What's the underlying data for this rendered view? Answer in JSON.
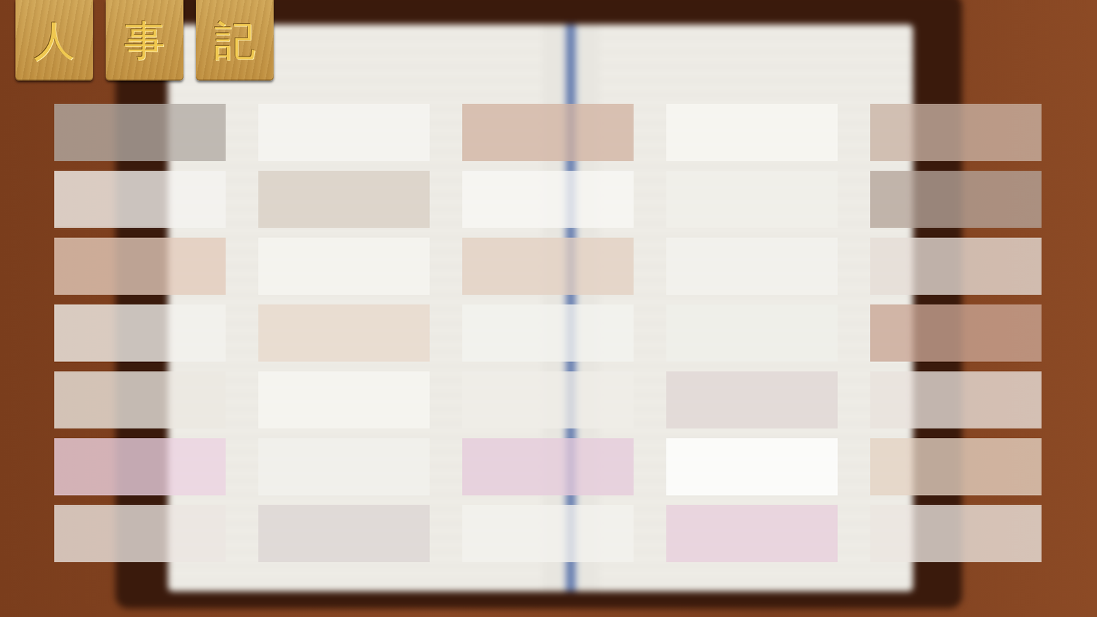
{
  "menu_tiles": [
    {
      "label": "人"
    },
    {
      "label": "事"
    },
    {
      "label": "記"
    }
  ],
  "grid": {
    "rows": [
      {
        "cards": [
          {
            "color": "#b2aaa4"
          },
          {
            "color": "#f6f5f2"
          },
          {
            "color": "#d2b3a3"
          },
          {
            "color": "#f8f7f4"
          },
          {
            "color": "#c9b2a4"
          }
        ]
      },
      {
        "cards": [
          {
            "color": "#f5f4f1"
          },
          {
            "color": "#d8cec4"
          },
          {
            "color": "#f8f7f5"
          },
          {
            "color": "#f1efea"
          },
          {
            "color": "#b5a49a"
          }
        ]
      },
      {
        "cards": [
          {
            "color": "#e3cbbb"
          },
          {
            "color": "#f6f5f1"
          },
          {
            "color": "#e3cfc2"
          },
          {
            "color": "#f3f2ee"
          },
          {
            "color": "#e6ddd6"
          }
        ]
      },
      {
        "cards": [
          {
            "color": "#f4f2ee"
          },
          {
            "color": "#e8d8cc"
          },
          {
            "color": "#f4f3ef"
          },
          {
            "color": "#f0efea"
          },
          {
            "color": "#c9a595"
          }
        ]
      },
      {
        "cards": [
          {
            "color": "#ece8e2"
          },
          {
            "color": "#f7f6f2"
          },
          {
            "color": "#efede8"
          },
          {
            "color": "#e0d6d5"
          },
          {
            "color": "#e9e2dc"
          }
        ]
      },
      {
        "cards": [
          {
            "color": "#ecd2e2"
          },
          {
            "color": "#f2f1ed"
          },
          {
            "color": "#e6cadb"
          },
          {
            "color": "#ffffff"
          },
          {
            "color": "#e4d2c3"
          }
        ]
      },
      {
        "cards": [
          {
            "color": "#ece6e2"
          },
          {
            "color": "#ddd5d3"
          },
          {
            "color": "#f3f2ee"
          },
          {
            "color": "#e8cedd"
          },
          {
            "color": "#ece6e0"
          }
        ]
      }
    ]
  }
}
